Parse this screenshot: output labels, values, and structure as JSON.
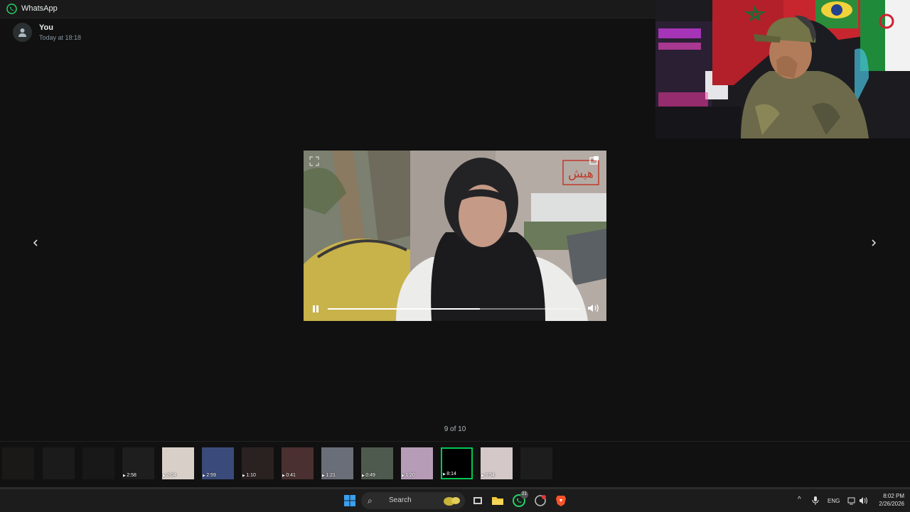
{
  "window": {
    "title": "WhatsApp"
  },
  "sender": {
    "name": "You",
    "time": "Today at 18:18"
  },
  "viewer": {
    "counter": "9 of 10",
    "playback_progress": 0.6,
    "watermark": "هيش"
  },
  "thumbnails": [
    {
      "duration": "",
      "dim": true
    },
    {
      "duration": "",
      "dim": true
    },
    {
      "duration": "",
      "dim": true
    },
    {
      "duration": "2:58"
    },
    {
      "duration": "2:04"
    },
    {
      "duration": "2:59"
    },
    {
      "duration": "1:10"
    },
    {
      "duration": "0:41"
    },
    {
      "duration": "1:21"
    },
    {
      "duration": "0:49"
    },
    {
      "duration": "1:20"
    },
    {
      "duration": "8:14",
      "active": true
    },
    {
      "duration": "3:54"
    },
    {
      "duration": "",
      "dim": true
    }
  ],
  "taskbar": {
    "search_label": "Search",
    "language": "ENG",
    "time": "8:02 PM",
    "date": "2/26/2026",
    "whatsapp_badge": "21"
  },
  "colors": {
    "accent": "#00c853",
    "brave": "#fb542b",
    "whatsapp": "#25d366"
  }
}
